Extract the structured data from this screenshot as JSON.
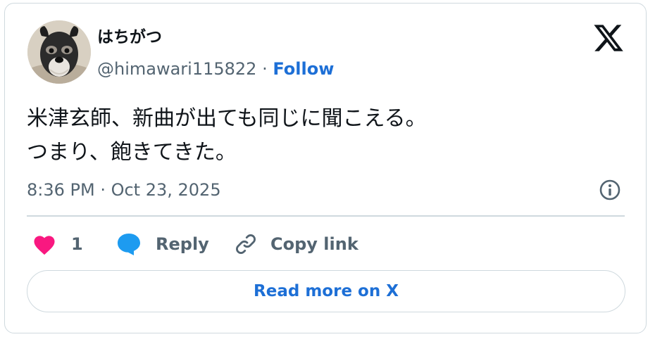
{
  "author": {
    "display_name": "はちがつ",
    "handle": "@himawari115822",
    "separator": "·",
    "follow_label": "Follow",
    "avatar_icon": "schnauzer-dog-avatar"
  },
  "tweet": {
    "lines": [
      "米津玄師、新曲が出ても同じに聞こえる。",
      "つまり、飽きてきた。"
    ],
    "timestamp": "8:36 PM · Oct 23, 2025"
  },
  "actions": {
    "like_count": "1",
    "reply_label": "Reply",
    "copy_link_label": "Copy link"
  },
  "read_more_label": "Read more on X",
  "icons": {
    "brand": "x-logo-icon",
    "info": "info-icon",
    "like": "heart-icon",
    "reply": "reply-bubble-icon",
    "copy": "link-icon"
  },
  "colors": {
    "link_blue": "#1d6fd6",
    "like_pink": "#f91880",
    "reply_blue": "#1d9bf0",
    "muted_gray": "#536471",
    "border": "#cfd9de"
  }
}
